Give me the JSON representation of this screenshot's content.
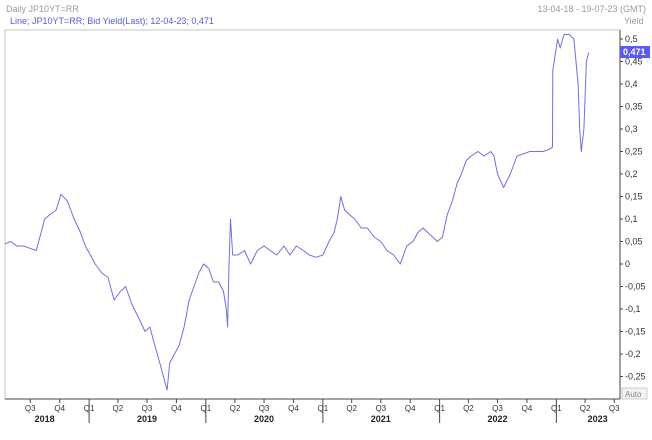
{
  "header": {
    "title": "Daily JP10YT=RR",
    "date_range": "13-04-18 - 19-07-23 (GMT)",
    "y_unit": "Yield"
  },
  "series_label": "Line; JP10YT=RR; Bid Yield(Last); 12-04-23; 0,471",
  "last_value_label": "0,471",
  "auto_label": "Auto",
  "colors": {
    "line": "#7070dd",
    "last_box": "#5a5af0",
    "axis": "#444444"
  },
  "chart_data": {
    "type": "line",
    "title": "Daily JP10YT=RR",
    "xlabel": "",
    "ylabel": "Yield",
    "x_range": [
      "2018-04-13",
      "2023-07-19"
    ],
    "ylim": [
      -0.3,
      0.52
    ],
    "y_ticks": [
      "0,5",
      "0,45",
      "0,4",
      "0,35",
      "0,3",
      "0,25",
      "0,2",
      "0,15",
      "0,1",
      "0,05",
      "0",
      "-0,05",
      "-0,1",
      "-0,15",
      "-0,2",
      "-0,25"
    ],
    "y_tick_values": [
      0.5,
      0.45,
      0.4,
      0.35,
      0.3,
      0.25,
      0.2,
      0.15,
      0.1,
      0.05,
      0,
      -0.05,
      -0.1,
      -0.15,
      -0.2,
      -0.25
    ],
    "quarter_ticks": [
      {
        "label": "Q3",
        "date": "2018-07-01"
      },
      {
        "label": "Q4",
        "date": "2018-10-01"
      },
      {
        "label": "Q1",
        "date": "2019-01-01"
      },
      {
        "label": "Q2",
        "date": "2019-04-01"
      },
      {
        "label": "Q3",
        "date": "2019-07-01"
      },
      {
        "label": "Q4",
        "date": "2019-10-01"
      },
      {
        "label": "Q1",
        "date": "2020-01-01"
      },
      {
        "label": "Q2",
        "date": "2020-04-01"
      },
      {
        "label": "Q3",
        "date": "2020-07-01"
      },
      {
        "label": "Q4",
        "date": "2020-10-01"
      },
      {
        "label": "Q1",
        "date": "2021-01-01"
      },
      {
        "label": "Q2",
        "date": "2021-04-01"
      },
      {
        "label": "Q3",
        "date": "2021-07-01"
      },
      {
        "label": "Q4",
        "date": "2021-10-01"
      },
      {
        "label": "Q1",
        "date": "2022-01-01"
      },
      {
        "label": "Q2",
        "date": "2022-04-01"
      },
      {
        "label": "Q3",
        "date": "2022-07-01"
      },
      {
        "label": "Q4",
        "date": "2022-10-01"
      },
      {
        "label": "Q1",
        "date": "2023-01-01"
      },
      {
        "label": "Q2",
        "date": "2023-04-01"
      },
      {
        "label": "Q3",
        "date": "2023-07-01"
      }
    ],
    "year_labels": [
      {
        "label": "2018",
        "date": "2018-08-15"
      },
      {
        "label": "2019",
        "date": "2019-07-01"
      },
      {
        "label": "2020",
        "date": "2020-07-01"
      },
      {
        "label": "2021",
        "date": "2021-07-01"
      },
      {
        "label": "2022",
        "date": "2022-07-01"
      },
      {
        "label": "2023",
        "date": "2023-05-10"
      }
    ],
    "series": [
      {
        "name": "JP10YT=RR",
        "x": [
          "2018-04-13",
          "2018-05-01",
          "2018-05-20",
          "2018-06-10",
          "2018-06-30",
          "2018-07-20",
          "2018-07-31",
          "2018-08-15",
          "2018-09-01",
          "2018-09-20",
          "2018-10-05",
          "2018-10-25",
          "2018-11-15",
          "2018-12-05",
          "2018-12-20",
          "2019-01-05",
          "2019-01-20",
          "2019-02-10",
          "2019-03-01",
          "2019-03-20",
          "2019-04-10",
          "2019-04-25",
          "2019-05-15",
          "2019-06-05",
          "2019-06-25",
          "2019-07-10",
          "2019-07-25",
          "2019-08-10",
          "2019-08-25",
          "2019-09-02",
          "2019-09-10",
          "2019-09-25",
          "2019-10-10",
          "2019-10-25",
          "2019-11-10",
          "2019-11-25",
          "2019-12-10",
          "2019-12-25",
          "2020-01-10",
          "2020-01-25",
          "2020-02-10",
          "2020-02-25",
          "2020-03-05",
          "2020-03-09",
          "2020-03-13",
          "2020-03-18",
          "2020-03-25",
          "2020-04-10",
          "2020-05-01",
          "2020-05-20",
          "2020-06-10",
          "2020-07-01",
          "2020-07-20",
          "2020-08-10",
          "2020-09-01",
          "2020-09-20",
          "2020-10-10",
          "2020-11-01",
          "2020-11-20",
          "2020-12-10",
          "2021-01-01",
          "2021-01-20",
          "2021-02-05",
          "2021-02-15",
          "2021-02-26",
          "2021-03-10",
          "2021-03-25",
          "2021-04-10",
          "2021-05-01",
          "2021-05-20",
          "2021-06-10",
          "2021-07-01",
          "2021-07-20",
          "2021-08-10",
          "2021-08-31",
          "2021-09-20",
          "2021-10-10",
          "2021-10-25",
          "2021-11-10",
          "2021-11-25",
          "2021-12-10",
          "2021-12-25",
          "2022-01-10",
          "2022-01-25",
          "2022-02-10",
          "2022-02-25",
          "2022-03-10",
          "2022-03-25",
          "2022-04-10",
          "2022-05-01",
          "2022-05-20",
          "2022-06-10",
          "2022-06-20",
          "2022-07-01",
          "2022-07-20",
          "2022-08-10",
          "2022-08-31",
          "2022-09-20",
          "2022-10-10",
          "2022-11-01",
          "2022-11-20",
          "2022-12-10",
          "2022-12-20",
          "2022-12-21",
          "2023-01-05",
          "2023-01-13",
          "2023-01-25",
          "2023-02-10",
          "2023-02-25",
          "2023-03-10",
          "2023-03-15",
          "2023-03-20",
          "2023-03-28",
          "2023-04-05",
          "2023-04-12"
        ],
        "values": [
          0.045,
          0.05,
          0.04,
          0.04,
          0.035,
          0.03,
          0.06,
          0.1,
          0.11,
          0.12,
          0.155,
          0.14,
          0.1,
          0.07,
          0.04,
          0.02,
          0.0,
          -0.02,
          -0.03,
          -0.08,
          -0.06,
          -0.05,
          -0.09,
          -0.12,
          -0.15,
          -0.14,
          -0.18,
          -0.22,
          -0.26,
          -0.28,
          -0.22,
          -0.2,
          -0.18,
          -0.14,
          -0.08,
          -0.05,
          -0.02,
          0.0,
          -0.01,
          -0.04,
          -0.04,
          -0.06,
          -0.1,
          -0.14,
          -0.01,
          0.1,
          0.02,
          0.02,
          0.03,
          0.0,
          0.03,
          0.04,
          0.03,
          0.02,
          0.04,
          0.02,
          0.04,
          0.03,
          0.02,
          0.015,
          0.02,
          0.05,
          0.07,
          0.1,
          0.15,
          0.12,
          0.11,
          0.1,
          0.08,
          0.08,
          0.06,
          0.05,
          0.03,
          0.02,
          0.0,
          0.04,
          0.05,
          0.07,
          0.08,
          0.07,
          0.06,
          0.05,
          0.06,
          0.11,
          0.14,
          0.18,
          0.2,
          0.23,
          0.24,
          0.25,
          0.24,
          0.25,
          0.24,
          0.2,
          0.17,
          0.2,
          0.24,
          0.245,
          0.25,
          0.25,
          0.25,
          0.255,
          0.26,
          0.43,
          0.5,
          0.48,
          0.51,
          0.51,
          0.5,
          0.4,
          0.3,
          0.25,
          0.3,
          0.45,
          0.47
        ]
      }
    ],
    "grid": false,
    "legend": "none",
    "last_value": 0.471
  }
}
